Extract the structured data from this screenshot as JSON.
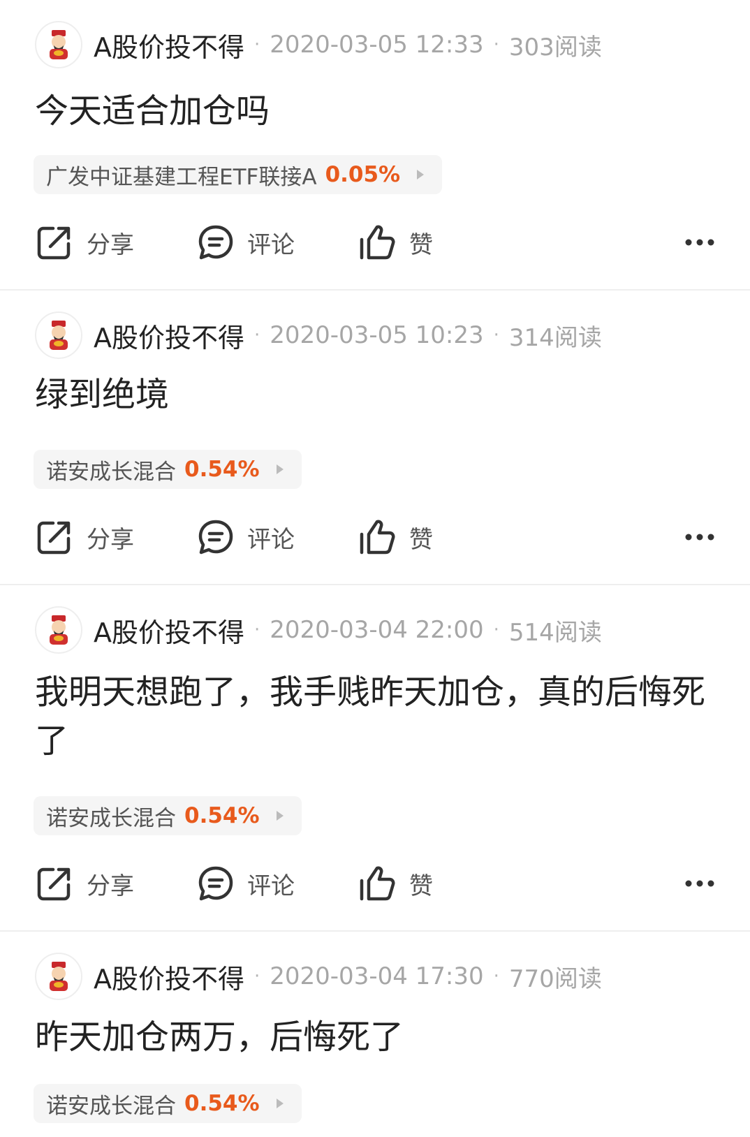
{
  "actions": {
    "share": "分享",
    "comment": "评论",
    "like": "赞"
  },
  "posts": [
    {
      "author": "A股价投不得",
      "time": "2020-03-05 12:33",
      "reads": "303阅读",
      "text": "今天适合加仓吗",
      "fund": {
        "name": "广发中证基建工程ETF联接A",
        "change": "0.05%"
      }
    },
    {
      "author": "A股价投不得",
      "time": "2020-03-05 10:23",
      "reads": "314阅读",
      "text": "绿到绝境",
      "fund": {
        "name": "诺安成长混合",
        "change": "0.54%"
      }
    },
    {
      "author": "A股价投不得",
      "time": "2020-03-04 22:00",
      "reads": "514阅读",
      "text": "我明天想跑了，我手贱昨天加仓，真的后悔死了",
      "fund": {
        "name": "诺安成长混合",
        "change": "0.54%"
      }
    },
    {
      "author": "A股价投不得",
      "time": "2020-03-04 17:30",
      "reads": "770阅读",
      "text": "昨天加仓两万，后悔死了",
      "fund": {
        "name": "诺安成长混合",
        "change": "0.54%"
      }
    }
  ]
}
